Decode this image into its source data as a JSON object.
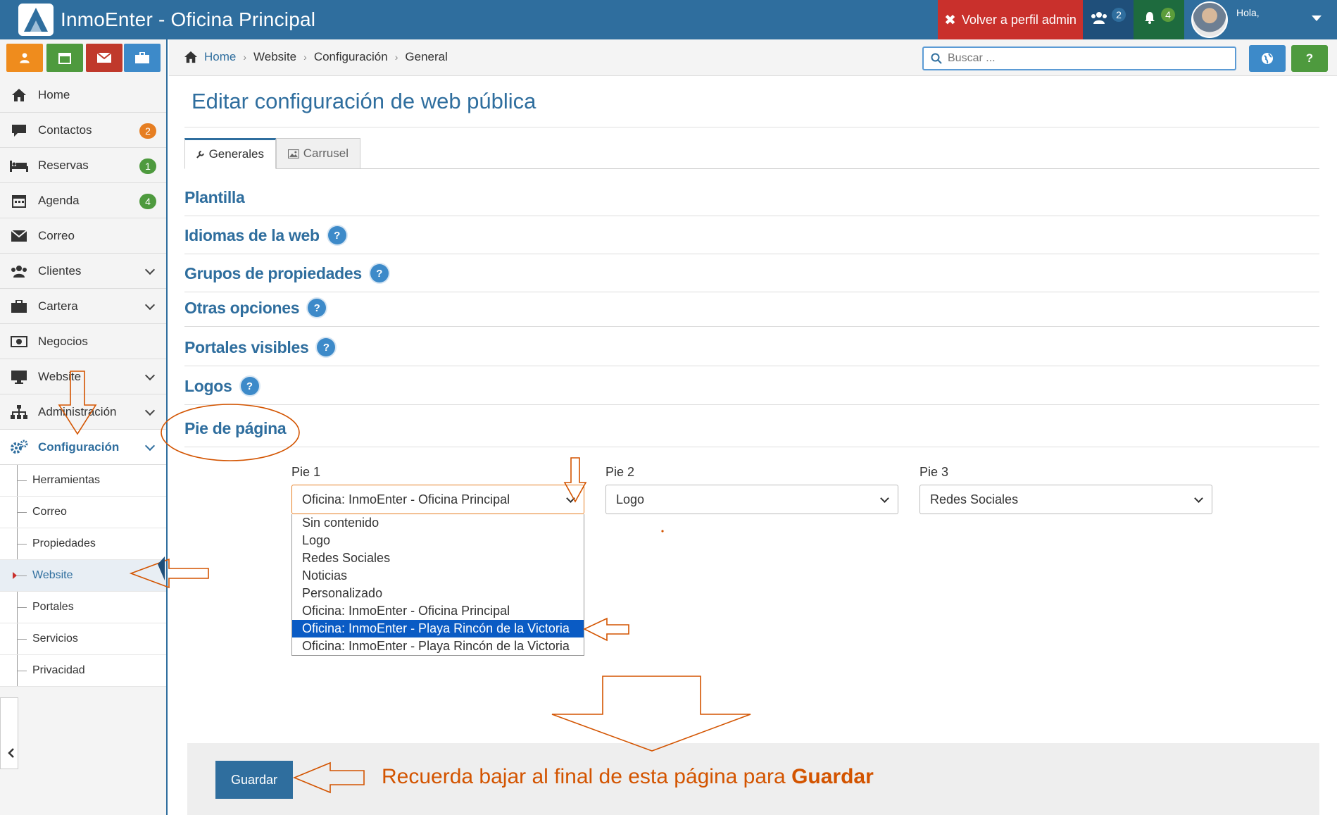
{
  "topbar": {
    "app_title": "InmoEnter - Oficina Principal",
    "admin_button": "Volver a perfil admin",
    "users_count": "2",
    "notifications_count": "4",
    "greeting": "Hola,"
  },
  "sidebar": {
    "items": [
      {
        "label": "Home",
        "icon": "home-icon"
      },
      {
        "label": "Contactos",
        "icon": "comment-icon",
        "badge": "2"
      },
      {
        "label": "Reservas",
        "icon": "bed-icon",
        "badge": "1"
      },
      {
        "label": "Agenda",
        "icon": "calendar-icon",
        "badge": "4"
      },
      {
        "label": "Correo",
        "icon": "envelope-icon"
      },
      {
        "label": "Clientes",
        "icon": "users-icon"
      },
      {
        "label": "Cartera",
        "icon": "briefcase-icon"
      },
      {
        "label": "Negocios",
        "icon": "money-icon"
      },
      {
        "label": "Website",
        "icon": "monitor-icon"
      },
      {
        "label": "Administración",
        "icon": "sitemap-icon"
      },
      {
        "label": "Configuración",
        "icon": "cogs-icon"
      }
    ],
    "sub_items": [
      "Herramientas",
      "Correo",
      "Propiedades",
      "Website",
      "Portales",
      "Servicios",
      "Privacidad"
    ]
  },
  "breadcrumb": {
    "home": "Home",
    "level1": "Website",
    "level2": "Configuración",
    "level3": "General"
  },
  "search": {
    "placeholder": "Buscar ..."
  },
  "help_button": "?",
  "page": {
    "title": "Editar configuración de web pública",
    "tabs": [
      "Generales",
      "Carrusel"
    ],
    "sections": [
      "Plantilla",
      "Idiomas de la web",
      "Grupos de propiedades",
      "Otras opciones",
      "Portales visibles",
      "Logos",
      "Pie de página"
    ],
    "help_mark": "?"
  },
  "footer": {
    "pie1_label": "Pie 1",
    "pie1_value": "Oficina: InmoEnter - Oficina Principal",
    "pie2_label": "Pie 2",
    "pie2_value": "Logo",
    "pie3_label": "Pie 3",
    "pie3_value": "Redes Sociales",
    "dropdown_options": [
      "Sin contenido",
      "Logo",
      "Redes Sociales",
      "Noticias",
      "Personalizado",
      "Oficina: InmoEnter - Oficina Principal",
      "Oficina: InmoEnter - Playa Rincón de la Victoria",
      "Oficina: InmoEnter - Playa Rincón de la Victoria"
    ],
    "highlighted_option_index": 6
  },
  "actions": {
    "save_label": "Guardar",
    "reminder_prefix": "Recuerda bajar al final de esta página para",
    "reminder_bold": "Guardar"
  },
  "colors": {
    "primary": "#2f6e9e",
    "danger": "#c9302c",
    "annotation": "#d35400",
    "selected_option": "#0a5bc4"
  }
}
